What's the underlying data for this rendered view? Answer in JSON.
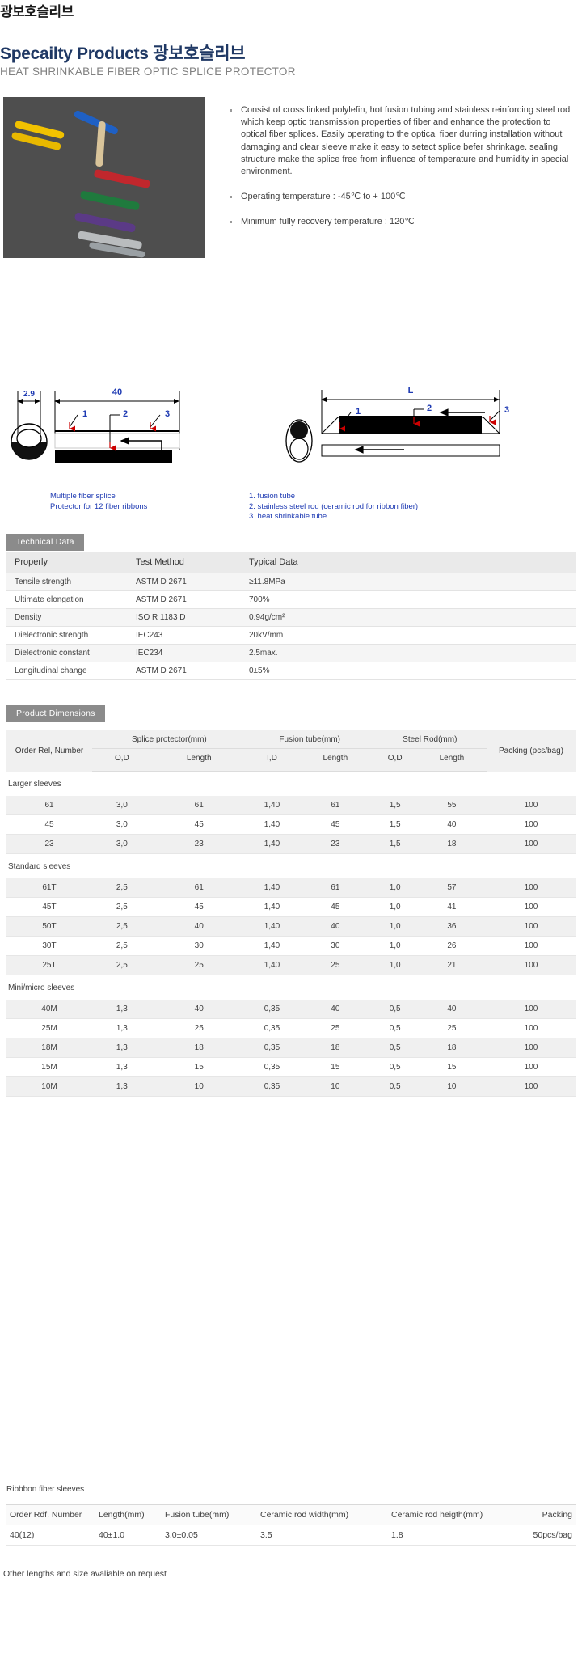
{
  "header": {
    "top_title": "광보호슬리브",
    "main_title": "Specailty Products 광보호슬리브",
    "sub_title": "HEAT SHRINKABLE FIBER OPTIC SPLICE PROTECTOR"
  },
  "features": {
    "bullets": [
      "Consist of cross linked polylefin, hot fusion tubing and stainless reinforcing steel rod which keep optic transmission properties of fiber and enhance the protection to optical fiber splices. Easily operating to the optical fiber durring installation without damaging and clear sleeve make it easy to setect splice befer shrinkage. sealing structure make the splice free from influence of temperature and humidity in special environment.",
      "Operating temperature : -45℃ to + 100℃",
      "Minimum fully recovery temperature : 120℃"
    ]
  },
  "diagrams": {
    "left": {
      "dim_width": "2.9",
      "dim_length": "40",
      "callouts": [
        "1",
        "2",
        "3"
      ],
      "caption": "Multiple fiber splice\nProtector for 12 fiber ribbons"
    },
    "right": {
      "dim_length": "L",
      "callouts": [
        "1",
        "2",
        "3"
      ],
      "legend": "1.  fusion tube\n2.  stainless steel rod (ceramic rod for ribbon fiber)\n3.  heat shrinkable tube"
    }
  },
  "technical": {
    "section_label": "Technical Data",
    "columns": [
      "Properly",
      "Test Method",
      "Typical Data"
    ],
    "rows": [
      [
        "Tensile strength",
        "ASTM D 2671",
        "≥11.8MPa"
      ],
      [
        "Ultimate elongation",
        "ASTM D 2671",
        "700%"
      ],
      [
        "Density",
        "ISO R 1183 D",
        "0.94g/cm²"
      ],
      [
        "Dielectronic strength",
        "IEC243",
        "20kV/mm"
      ],
      [
        "Dielectronic constant",
        "IEC234",
        "2.5max."
      ],
      [
        "Longitudinal change",
        "ASTM D 2671",
        "0±5%"
      ]
    ]
  },
  "dimensions": {
    "section_label": "Product Dimensions",
    "header": {
      "order": "Order Rel, Number",
      "groups": [
        "Splice protector(mm)",
        "Fusion tube(mm)",
        "Steel Rod(mm)"
      ],
      "subs": [
        "O,D",
        "Length",
        "I,D",
        "Length",
        "O,D",
        "Length"
      ],
      "packing": "Packing (pcs/bag)"
    },
    "groups": [
      {
        "name": "Larger sleeves",
        "rows": [
          [
            "61",
            "3,0",
            "61",
            "1,40",
            "61",
            "1,5",
            "55",
            "100"
          ],
          [
            "45",
            "3,0",
            "45",
            "1,40",
            "45",
            "1,5",
            "40",
            "100"
          ],
          [
            "23",
            "3,0",
            "23",
            "1,40",
            "23",
            "1,5",
            "18",
            "100"
          ]
        ]
      },
      {
        "name": "Standard sleeves",
        "rows": [
          [
            "61T",
            "2,5",
            "61",
            "1,40",
            "61",
            "1,0",
            "57",
            "100"
          ],
          [
            "45T",
            "2,5",
            "45",
            "1,40",
            "45",
            "1,0",
            "41",
            "100"
          ],
          [
            "50T",
            "2,5",
            "40",
            "1,40",
            "40",
            "1,0",
            "36",
            "100"
          ],
          [
            "30T",
            "2,5",
            "30",
            "1,40",
            "30",
            "1,0",
            "26",
            "100"
          ],
          [
            "25T",
            "2,5",
            "25",
            "1,40",
            "25",
            "1,0",
            "21",
            "100"
          ]
        ]
      },
      {
        "name": "Mini/micro sleeves",
        "rows": [
          [
            "40M",
            "1,3",
            "40",
            "0,35",
            "40",
            "0,5",
            "40",
            "100"
          ],
          [
            "25M",
            "1,3",
            "25",
            "0,35",
            "25",
            "0,5",
            "25",
            "100"
          ],
          [
            "18M",
            "1,3",
            "18",
            "0,35",
            "18",
            "0,5",
            "18",
            "100"
          ],
          [
            "15M",
            "1,3",
            "15",
            "0,35",
            "15",
            "0,5",
            "15",
            "100"
          ],
          [
            "10M",
            "1,3",
            "10",
            "0,35",
            "10",
            "0,5",
            "10",
            "100"
          ]
        ]
      }
    ]
  },
  "ribbon": {
    "label": "Ribbbon fiber sleeves",
    "columns": [
      "Order Rdf. Number",
      "Length(mm)",
      "Fusion tube(mm)",
      "Ceramic rod width(mm)",
      "Ceramic rod heigth(mm)",
      "Packing"
    ],
    "rows": [
      [
        "40(12)",
        "40±1.0",
        "3.0±0.05",
        "3.5",
        "1.8",
        "50pcs/bag"
      ]
    ]
  },
  "footnote": "Other lengths and size avaliable on request",
  "colors": {
    "brand_navy": "#1f3864",
    "section_tab_bg": "#8b8b8b",
    "diagram_blue": "#1f3bb3",
    "callout_red": "#cc0000"
  }
}
